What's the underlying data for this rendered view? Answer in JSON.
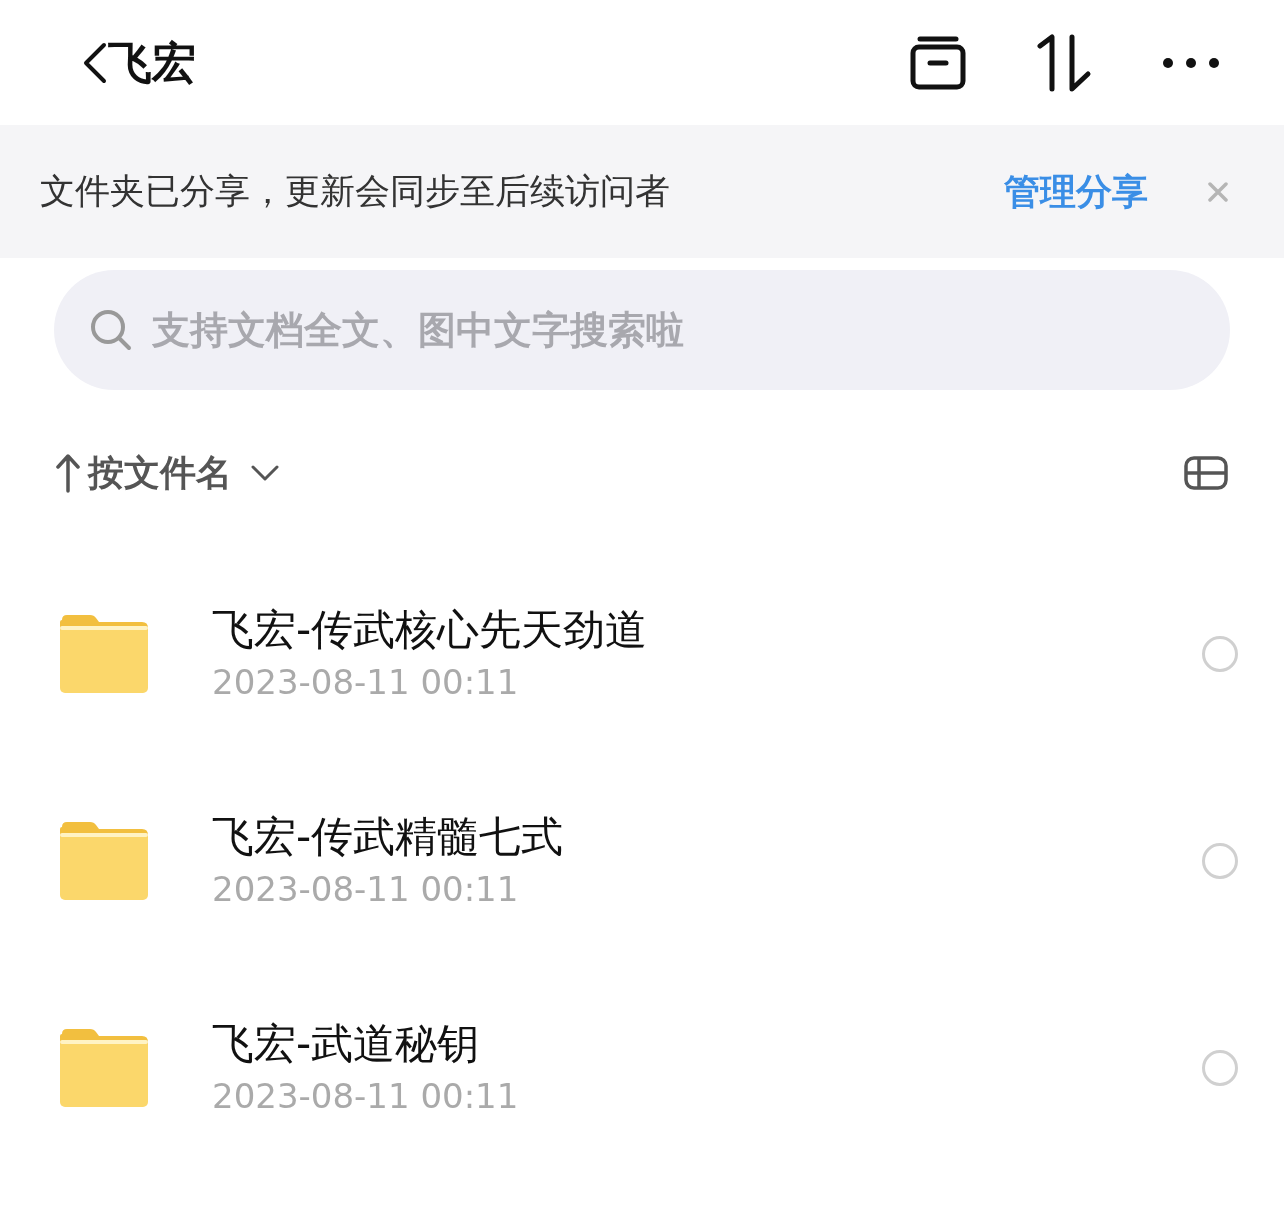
{
  "header": {
    "title": "飞宏"
  },
  "banner": {
    "text": "文件夹已分享，更新会同步至后续访问者",
    "link": "管理分享"
  },
  "search": {
    "placeholder": "支持文档全文、图中文字搜索啦"
  },
  "sort": {
    "label": "按文件名"
  },
  "files": [
    {
      "name": "飞宏-传武核心先天劲道",
      "date": "2023-08-11 00:11",
      "selected": false
    },
    {
      "name": "飞宏-传武精髓七式",
      "date": "2023-08-11 00:11",
      "selected": false
    },
    {
      "name": "飞宏-武道秘钥",
      "date": "2023-08-11 00:11",
      "selected": false
    }
  ]
}
